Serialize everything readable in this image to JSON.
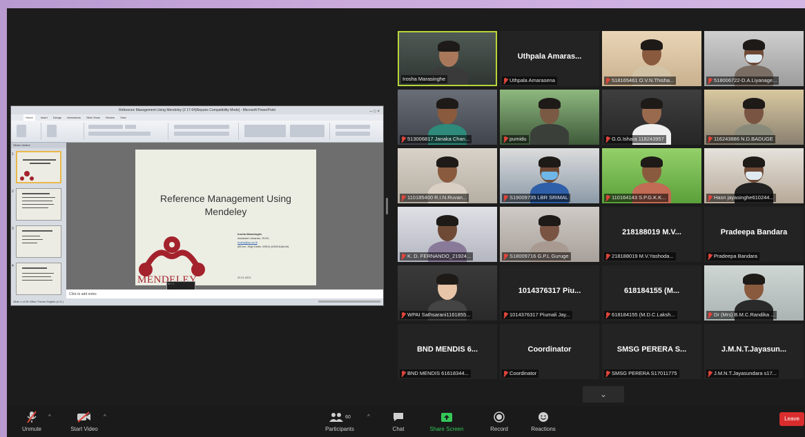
{
  "powerpoint": {
    "window_title": "Reference Management Using Mendeley (2 17-04)Repairs Compatibility Mode] - Microsoft PowerPoint",
    "tabs": [
      "Home",
      "Insert",
      "Design",
      "Animations",
      "Slide Show",
      "Review",
      "View"
    ],
    "slide": {
      "title": "Reference Management Using Mendeley",
      "logo_word": "MENDELEY",
      "author_lines": [
        "Irosha Marasinghe",
        "Assistant Librarian, OUSL",
        "irosha@ou.ac.lk",
        "(BCom, High Distin, MSLib (UNICA)lwLbl)"
      ],
      "date": "25.11.2021"
    },
    "notes_placeholder": "Click to add notes",
    "status_text": "Slide 1 of 25   Office Theme   English (U.S.)"
  },
  "participants": [
    {
      "label": "Irosha Marasinghe",
      "center": "",
      "video": true,
      "active": true,
      "muted": false
    },
    {
      "label": "Uthpala Amarasena",
      "center": "Uthpala Amaras...",
      "video": false,
      "muted": true
    },
    {
      "label": "518165461 O.V.N.Thisha...",
      "center": "",
      "video": true,
      "muted": true
    },
    {
      "label": "518006722-D.A.Liyanage...",
      "center": "",
      "video": true,
      "muted": true
    },
    {
      "label": "513006817 Janaka Chan...",
      "center": "",
      "video": true,
      "muted": true
    },
    {
      "label": "pumidu",
      "center": "",
      "video": true,
      "muted": true
    },
    {
      "label": "G.G.Ishara 118243957",
      "center": "",
      "video": true,
      "muted": true
    },
    {
      "label": "116243886 N.D.BADUGE",
      "center": "",
      "video": true,
      "muted": true
    },
    {
      "label": "110185400 R.I.N.Ruvan...",
      "center": "",
      "video": true,
      "muted": true
    },
    {
      "label": "S19009735 LBR SRIMAL",
      "center": "",
      "video": true,
      "muted": true
    },
    {
      "label": "110164143 S.P.G.K.K...",
      "center": "",
      "video": true,
      "muted": true
    },
    {
      "label": "Hasn jayasinghe610244...",
      "center": "",
      "video": true,
      "muted": true
    },
    {
      "label": "K. D. FERNANDO_21924...",
      "center": "",
      "video": true,
      "muted": true
    },
    {
      "label": "S18009716 G.P.L Guruge",
      "center": "",
      "video": true,
      "muted": true
    },
    {
      "label": "218188019 M.V.Yashoda...",
      "center": "218188019 M.V...",
      "video": false,
      "muted": true
    },
    {
      "label": "Pradeepa Bandara",
      "center": "Pradeepa Bandara",
      "video": false,
      "muted": true
    },
    {
      "label": "WPAI Sathsarani1161855...",
      "center": "",
      "video": true,
      "muted": true
    },
    {
      "label": "1014376317 Piumali Jay...",
      "center": "1014376317 Piu...",
      "video": false,
      "muted": true
    },
    {
      "label": "618184155 (M.D.C.Laksh...",
      "center": "618184155 (M...",
      "video": false,
      "muted": true
    },
    {
      "label": "Dr (Mrs) B.M.C.Randika ...",
      "center": "",
      "video": true,
      "muted": true
    },
    {
      "label": "BND MENDIS 61618344...",
      "center": "BND MENDIS 6...",
      "video": false,
      "muted": true
    },
    {
      "label": "Coordinator",
      "center": "Coordinator",
      "video": false,
      "muted": true
    },
    {
      "label": "SMSG PERERA S17011775",
      "center": "SMSG PERERA S...",
      "video": false,
      "muted": true
    },
    {
      "label": "J.M.N.T.Jayasundara s17...",
      "center": "J.M.N.T.Jayasun...",
      "video": false,
      "muted": true
    }
  ],
  "toolbar": {
    "unmute": "Unmute",
    "start_video": "Start Video",
    "participants": "Participants",
    "participants_count": "60",
    "chat": "Chat",
    "share_screen": "Share Screen",
    "record": "Record",
    "reactions": "Reactions",
    "leave": "Leave"
  },
  "colors": {
    "active_speaker_border": "#b9d63a",
    "share_green": "#34c759",
    "leave_red": "#d92d2d",
    "mendeley_red": "#a3222c"
  }
}
